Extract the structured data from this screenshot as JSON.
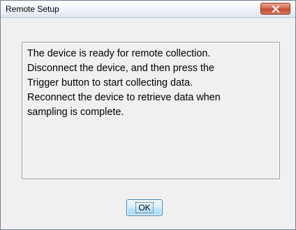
{
  "window": {
    "title": "Remote Setup",
    "close_icon": "close-icon"
  },
  "message": {
    "lines": [
      "The device is ready for remote collection.",
      "Disconnect the device, and then press the",
      "Trigger button to start collecting data.",
      "Reconnect the device to retrieve data when",
      "sampling is complete."
    ]
  },
  "buttons": {
    "ok_label": "OK"
  },
  "colors": {
    "close_button": "#c9553a",
    "ok_border": "#3c7fb1",
    "dialog_bg": "#f0f0f0"
  }
}
